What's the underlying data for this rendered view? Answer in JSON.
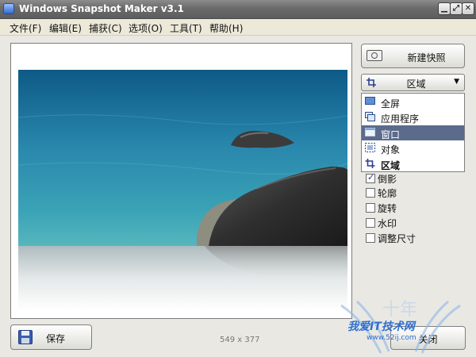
{
  "window": {
    "title": "Windows Snapshot Maker v3.1"
  },
  "menu": {
    "items": [
      "文件(F)",
      "编辑(E)",
      "捕获(C)",
      "选项(O)",
      "工具(T)",
      "帮助(H)"
    ]
  },
  "toolbar": {
    "new_snapshot": "新建快照"
  },
  "capture_mode": {
    "selected": "区域",
    "options": [
      {
        "label": "全屏",
        "icon": "monitor-icon"
      },
      {
        "label": "应用程序",
        "icon": "windows-icon"
      },
      {
        "label": "窗口",
        "icon": "window-icon",
        "highlighted": true
      },
      {
        "label": "对象",
        "icon": "object-select-icon"
      },
      {
        "label": "区域",
        "icon": "crop-icon",
        "bold": true
      }
    ]
  },
  "effects": [
    {
      "label": "倒影",
      "checked": true
    },
    {
      "label": "轮廓",
      "checked": false
    },
    {
      "label": "旋转",
      "checked": false
    },
    {
      "label": "水印",
      "checked": false
    },
    {
      "label": "调整尺寸",
      "checked": false
    }
  ],
  "footer": {
    "save": "保存",
    "image_size": "549 x 377",
    "close": "关闭"
  },
  "watermark": {
    "text": "我爱IT技术网",
    "url": "www.52ij.com"
  },
  "colors": {
    "titlebar": "#6a6a6a",
    "selection": "#5b6b8c",
    "sea": "#2e7fa3",
    "rock": "#3a3a3a"
  }
}
